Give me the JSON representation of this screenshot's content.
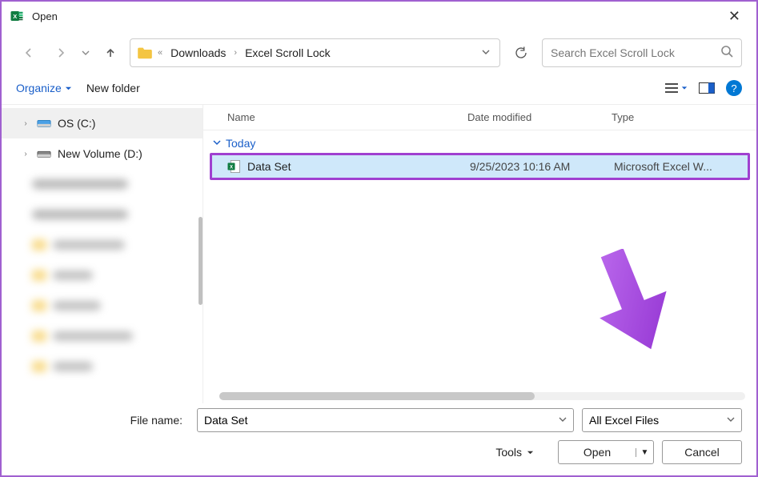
{
  "window": {
    "title": "Open"
  },
  "breadcrumb": {
    "parent": "Downloads",
    "current": "Excel Scroll Lock"
  },
  "search": {
    "placeholder": "Search Excel Scroll Lock"
  },
  "toolbar": {
    "organize": "Organize",
    "new_folder": "New folder"
  },
  "sidebar": {
    "items": [
      {
        "label": "OS (C:)"
      },
      {
        "label": "New Volume (D:)"
      }
    ]
  },
  "columns": {
    "name": "Name",
    "date": "Date modified",
    "type": "Type"
  },
  "group": {
    "label": "Today"
  },
  "files": [
    {
      "name": "Data Set",
      "date": "9/25/2023 10:16 AM",
      "type": "Microsoft Excel W..."
    }
  ],
  "footer": {
    "filename_label": "File name:",
    "filename_value": "Data Set",
    "filter": "All Excel Files",
    "tools": "Tools",
    "open": "Open",
    "cancel": "Cancel"
  }
}
